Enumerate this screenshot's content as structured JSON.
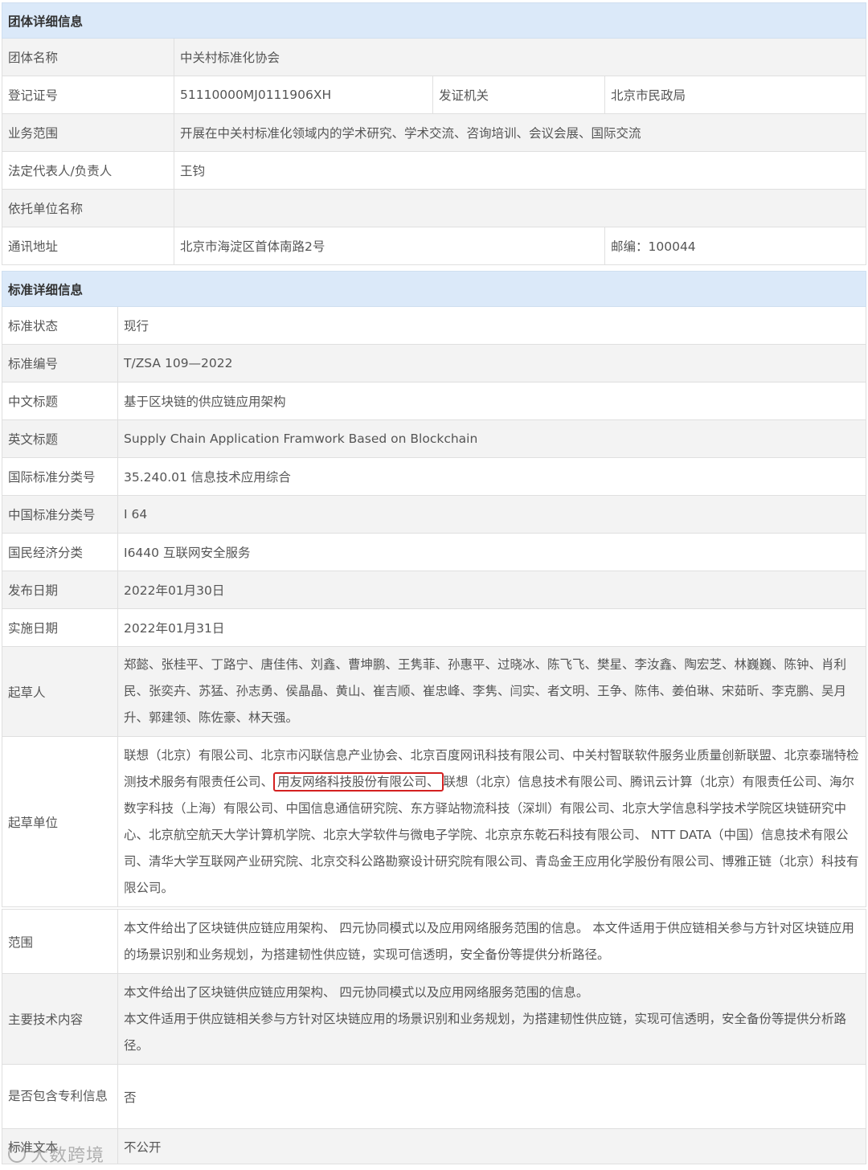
{
  "group": {
    "header": "团体详细信息",
    "name_label": "团体名称",
    "name_value": "中关村标准化协会",
    "reg_label": "登记证号",
    "reg_value": "51110000MJ0111906XH",
    "issuer_label": "发证机关",
    "issuer_value": "北京市民政局",
    "scope_label": "业务范围",
    "scope_value": "开展在中关村标准化领域内的学术研究、学术交流、咨询培训、会议会展、国际交流",
    "rep_label": "法定代表人/负责人",
    "rep_value": "王钧",
    "sponsor_label": "依托单位名称",
    "sponsor_value": "",
    "addr_label": "通讯地址",
    "addr_value": "北京市海淀区首体南路2号",
    "postcode_value": "邮编：100044"
  },
  "standard": {
    "header": "标准详细信息",
    "status_label": "标准状态",
    "status_value": "现行",
    "number_label": "标准编号",
    "number_value": "T/ZSA 109—2022",
    "cn_title_label": "中文标题",
    "cn_title_value": "基于区块链的供应链应用架构",
    "en_title_label": "英文标题",
    "en_title_value": "Supply Chain Application Framwork Based on Blockchain",
    "ics_label": "国际标准分类号",
    "ics_value": "35.240.01 信息技术应用综合",
    "ccs_label": "中国标准分类号",
    "ccs_value": "I 64",
    "econ_label": "国民经济分类",
    "econ_value": "I6440 互联网安全服务",
    "pub_label": "发布日期",
    "pub_value": "2022年01月30日",
    "impl_label": "实施日期",
    "impl_value": "2022年01月31日",
    "drafters_label": "起草人",
    "drafters_value": "郑懿、张桂平、丁路宁、唐佳伟、刘鑫、曹坤鹏、王隽菲、孙惠平、过晓冰、陈飞飞、樊星、李汝鑫、陶宏芝、林巍巍、陈钟、肖利民、张奕卉、苏猛、孙志勇、侯晶晶、黄山、崔吉顺、崔忠峰、李隽、闫实、者文明、王争、陈伟、姜伯琳、宋茹昕、李克鹏、吴月升、郭建领、陈佐豪、林天强。",
    "units_label": "起草单位",
    "units_before": "联想（北京）有限公司、北京市闪联信息产业协会、北京百度网讯科技有限公司、中关村智联软件服务业质量创新联盟、北京泰瑞特检测技术服务有限责任公司、",
    "units_highlight": "用友网络科技股份有限公司、",
    "units_after": "联想（北京）信息技术有限公司、腾讯云计算（北京）有限责任公司、海尔数字科技（上海）有限公司、中国信息通信研究院、东方驿站物流科技（深圳）有限公司、北京大学信息科学技术学院区块链研究中心、北京航空航天大学计算机学院、北京大学软件与微电子学院、北京京东乾石科技有限公司、 NTT DATA（中国）信息技术有限公司、清华大学互联网产业研究院、北京交科公路勘察设计研究院有限公司、青岛金王应用化学股份有限公司、博雅正链（北京）科技有限公司。"
  },
  "details": {
    "range_label": "范围",
    "range_value": "本文件给出了区块链供应链应用架构、 四元协同模式以及应用网络服务范围的信息。 本文件适用于供应链相关参与方针对区块链应用的场景识别和业务规划，为搭建韧性供应链，实现可信透明，安全备份等提供分析路径。",
    "tech_label": "主要技术内容",
    "tech_line1": "本文件给出了区块链供应链应用架构、 四元协同模式以及应用网络服务范围的信息。",
    "tech_line2": "本文件适用于供应链相关参与方针对区块链应用的场景识别和业务规划，为搭建韧性供应链，实现可信透明，安全备份等提供分析路径。",
    "patent_label": "是否包含专利信息",
    "patent_value": "否",
    "text_label": "标准文本",
    "text_value": "不公开"
  },
  "watermark": "大数跨境"
}
